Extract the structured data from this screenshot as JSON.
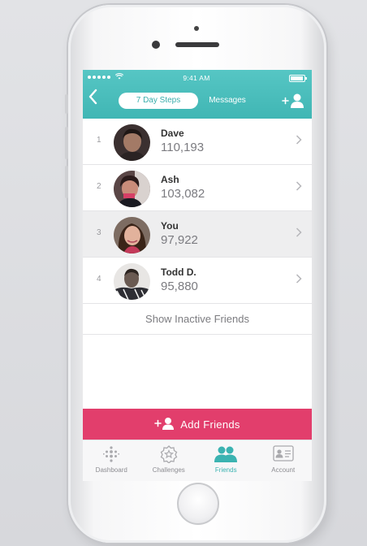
{
  "status_bar": {
    "time": "9:41 AM"
  },
  "header": {
    "segments": [
      {
        "label": "7 Day Steps",
        "active": true
      },
      {
        "label": "Messages",
        "active": false
      }
    ],
    "accent_color": "#40b6b4"
  },
  "friends": [
    {
      "rank": "1",
      "name": "Dave",
      "steps": "110,193",
      "highlight": false
    },
    {
      "rank": "2",
      "name": "Ash",
      "steps": "103,082",
      "highlight": false
    },
    {
      "rank": "3",
      "name": "You",
      "steps": "97,922",
      "highlight": true
    },
    {
      "rank": "4",
      "name": "Todd D.",
      "steps": "95,880",
      "highlight": false
    }
  ],
  "show_inactive_label": "Show Inactive Friends",
  "add_friends": {
    "label": "Add Friends",
    "color": "#e23e6c"
  },
  "tabs": [
    {
      "label": "Dashboard",
      "icon": "dashboard-dots-icon",
      "active": false
    },
    {
      "label": "Challenges",
      "icon": "challenges-badge-icon",
      "active": false
    },
    {
      "label": "Friends",
      "icon": "friends-icon",
      "active": true
    },
    {
      "label": "Account",
      "icon": "account-card-icon",
      "active": false
    }
  ]
}
